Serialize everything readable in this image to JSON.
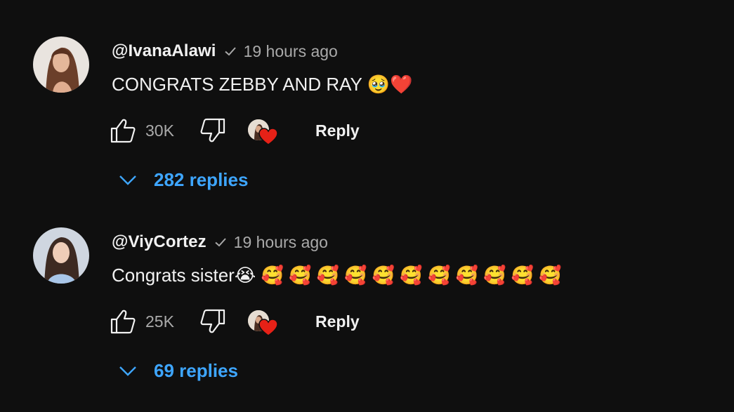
{
  "colors": {
    "background": "#0f0f0f",
    "text_primary": "#f1f1f1",
    "text_secondary": "#aaaaaa",
    "link_blue": "#3ea6ff",
    "heart_red": "#e62117"
  },
  "comments": [
    {
      "author": "@IvanaAlawi",
      "verified": true,
      "time": "19 hours ago",
      "text": "CONGRATS ZEBBY AND RAY 🥹❤️",
      "like_count": "30K",
      "creator_hearted": true,
      "reply_label": "Reply",
      "replies_label": "282 replies"
    },
    {
      "author": "@ViyCortez",
      "verified": true,
      "time": "19 hours ago",
      "text": "Congrats sister😭 🥰 🥰 🥰 🥰 🥰 🥰 🥰 🥰 🥰 🥰 🥰",
      "like_count": "25K",
      "creator_hearted": true,
      "reply_label": "Reply",
      "replies_label": "69 replies"
    }
  ],
  "icons": {
    "like": "thumbs-up-icon",
    "dislike": "thumbs-down-icon",
    "verified": "checkmark-icon",
    "expand": "chevron-down-icon",
    "creator_heart": "heart-icon"
  }
}
